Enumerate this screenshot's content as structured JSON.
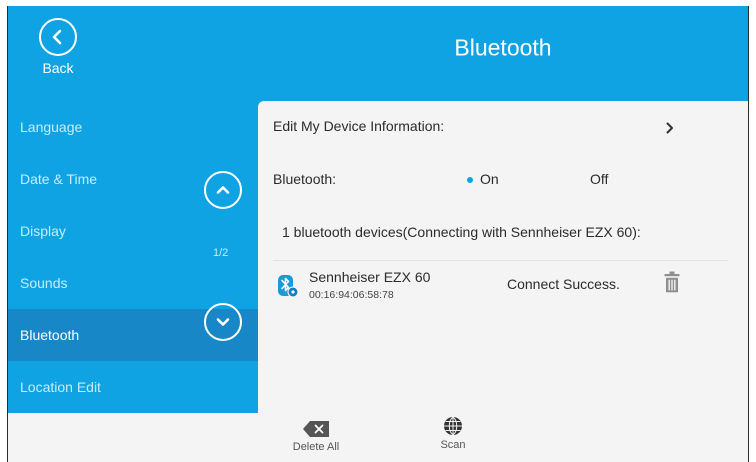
{
  "header": {
    "back_label": "Back",
    "title": "Bluetooth"
  },
  "sidebar": {
    "items": [
      {
        "label": "Language"
      },
      {
        "label": "Date & Time"
      },
      {
        "label": "Display"
      },
      {
        "label": "Sounds"
      },
      {
        "label": "Bluetooth",
        "active": true
      },
      {
        "label": "Location Edit"
      }
    ],
    "page_indicator": "1/2"
  },
  "content": {
    "edit_device_label": "Edit My Device Information:",
    "bluetooth_label": "Bluetooth:",
    "option_on": "On",
    "option_off": "Off",
    "selected_option": "On",
    "devices_summary": "1 bluetooth devices(Connecting with Sennheiser EZX 60):",
    "device": {
      "name": "Sennheiser EZX 60",
      "address": "00:16:94:06:58:78",
      "status": "Connect Success.",
      "icon": "bluetooth-headset-icon"
    }
  },
  "bottombar": {
    "delete_all_label": "Delete All",
    "scan_label": "Scan"
  },
  "colors": {
    "accent": "#0fa3e3",
    "sidebar_active": "#1787c8",
    "panel": "#f4f4f4",
    "sidebar_text": "#c7ecfa"
  }
}
